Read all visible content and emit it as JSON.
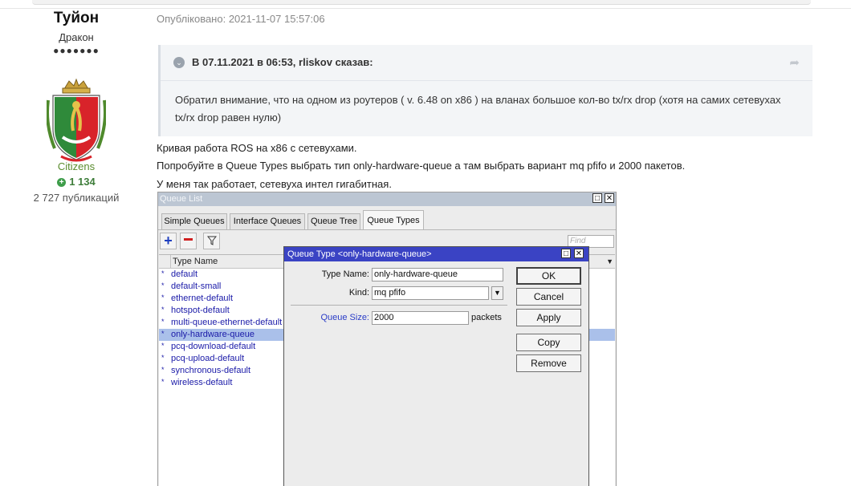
{
  "author": {
    "name": "Туйон",
    "title": "Дракон",
    "rank_dots": "●●●●●●●",
    "group": "Citizens",
    "reputation": "1 134",
    "posts": "2 727 публикаций"
  },
  "post": {
    "published": "Опубліковано: 2021-11-07 15:57:06",
    "quote": {
      "author": "В 07.11.2021 в 06:53, rliskov сказав:",
      "text": "Обратил внимание, что на одном из роутеров ( v. 6.48 on x86 ) на вланах большое кол-во tx/rx drop (хотя на самих сетевухах tx/rx drop равен нулю)"
    },
    "lines": [
      "Кривая работа ROS на x86 с сетевухами.",
      "Попробуйте в Queue Types выбрать тип only-hardware-queue а там выбрать вариант mq pfifo и 2000 пакетов.",
      "У меня так работает, сетевуха интел гигабитная."
    ]
  },
  "queue_list": {
    "title": "Queue List",
    "tabs": [
      "Simple Queues",
      "Interface Queues",
      "Queue Tree",
      "Queue Types"
    ],
    "active_tab": "Queue Types",
    "find_placeholder": "Find",
    "column": "Type Name",
    "rows": [
      "default",
      "default-small",
      "ethernet-default",
      "hotspot-default",
      "multi-queue-ethernet-default",
      "only-hardware-queue",
      "pcq-download-default",
      "pcq-upload-default",
      "synchronous-default",
      "wireless-default"
    ],
    "selected_row": "only-hardware-queue"
  },
  "dialog": {
    "title": "Queue Type <only-hardware-queue>",
    "type_name_label": "Type Name:",
    "type_name_value": "only-hardware-queue",
    "kind_label": "Kind:",
    "kind_value": "mq pfifo",
    "queue_size_label": "Queue Size:",
    "queue_size_value": "2000",
    "queue_size_unit": "packets",
    "buttons": {
      "ok": "OK",
      "cancel": "Cancel",
      "apply": "Apply",
      "copy": "Copy",
      "remove": "Remove"
    }
  }
}
